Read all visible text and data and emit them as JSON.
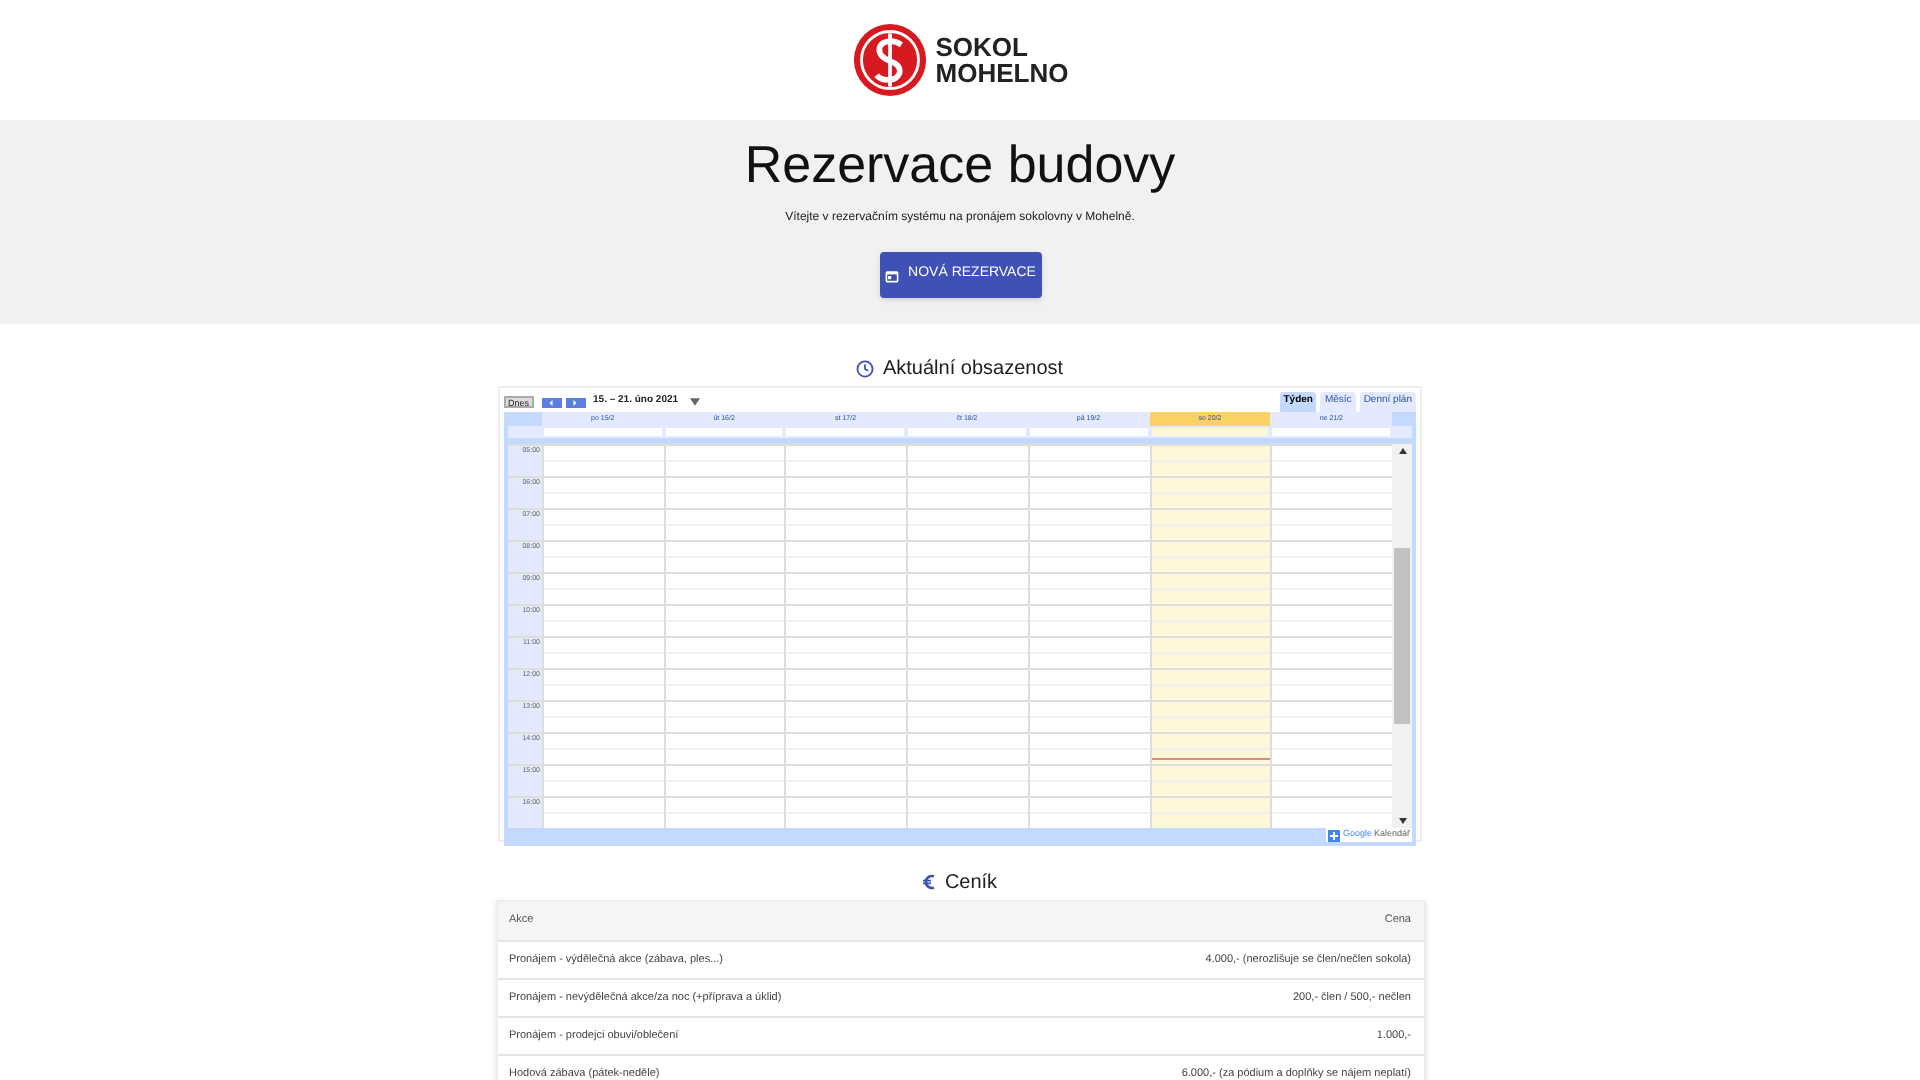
{
  "logo": {
    "line1": "SOKOL",
    "line2": "MOHELNO"
  },
  "hero": {
    "title": "Rezervace budovy",
    "subtitle": "Vítejte v rezervačním systému na pronájem sokolovny v Mohelně.",
    "button": "NOVÁ REZERVACE"
  },
  "calendar": {
    "heading": "Aktuální obsazenost",
    "today_button": "Dnes",
    "date_range": "15. – 21. úno 2021",
    "views": [
      {
        "label": "Týden",
        "selected": true
      },
      {
        "label": "Měsíc",
        "selected": false
      },
      {
        "label": "Denní plán",
        "selected": false
      }
    ],
    "days": [
      {
        "label": "po 15/2",
        "today": false
      },
      {
        "label": "út 16/2",
        "today": false
      },
      {
        "label": "st 17/2",
        "today": false
      },
      {
        "label": "čt 18/2",
        "today": false
      },
      {
        "label": "pá 19/2",
        "today": false
      },
      {
        "label": "so 20/2",
        "today": true
      },
      {
        "label": "ne 21/2",
        "today": false
      }
    ],
    "hours": [
      "05:00",
      "06:00",
      "07:00",
      "08:00",
      "09:00",
      "10:00",
      "11:00",
      "12:00",
      "13:00",
      "14:00",
      "15:00",
      "16:00"
    ],
    "footer_brand": "Google",
    "footer_label": "Kalendář"
  },
  "pricing": {
    "heading": "Ceník",
    "columns": [
      "Akce",
      "Cena"
    ],
    "rows": [
      [
        "Pronájem - výdělečná akce (zábava, ples...)",
        "4.000,- (nerozlišuje se člen/nečlen sokola)"
      ],
      [
        "Pronájem - nevýdělečná akce/za noc (+příprava a úklid)",
        "200,- člen / 500,- nečlen"
      ],
      [
        "Pronájem - prodejci obuvi/oblečení",
        "1.000,-"
      ],
      [
        "Hodová zábava (pátek-neděle)",
        "6.000,- (za pódium a doplňky se nájem neplatí)"
      ]
    ]
  }
}
